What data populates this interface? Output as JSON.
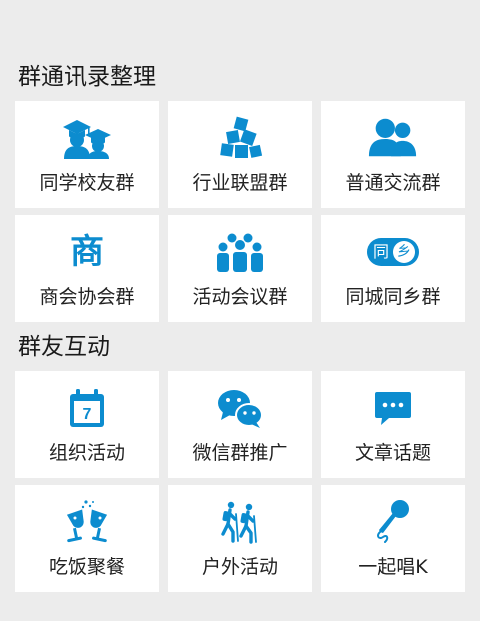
{
  "colors": {
    "accent": "#0c8ccf",
    "background": "#ececec",
    "tile": "#ffffff",
    "text": "#222222"
  },
  "section1": {
    "title": "群通讯录整理",
    "items": [
      {
        "label": "同学校友群",
        "icon": "graduation-caps-icon"
      },
      {
        "label": "行业联盟群",
        "icon": "cubes-icon"
      },
      {
        "label": "普通交流群",
        "icon": "two-people-icon"
      },
      {
        "label": "商会协会群",
        "icon": "shang-character-icon",
        "glyph": "商"
      },
      {
        "label": "活动会议群",
        "icon": "group-people-icon"
      },
      {
        "label": "同城同乡群",
        "icon": "tongxiang-badge-icon",
        "glyph_left": "同",
        "glyph_right": "乡"
      }
    ]
  },
  "section2": {
    "title": "群友互动",
    "items": [
      {
        "label": "组织活动",
        "icon": "calendar-icon",
        "glyph": "7"
      },
      {
        "label": "微信群推广",
        "icon": "wechat-icon"
      },
      {
        "label": "文章话题",
        "icon": "chat-bubble-icon"
      },
      {
        "label": "吃饭聚餐",
        "icon": "wine-glasses-icon"
      },
      {
        "label": "户外活动",
        "icon": "hikers-icon"
      },
      {
        "label": "一起唱K",
        "icon": "microphone-icon"
      }
    ]
  }
}
